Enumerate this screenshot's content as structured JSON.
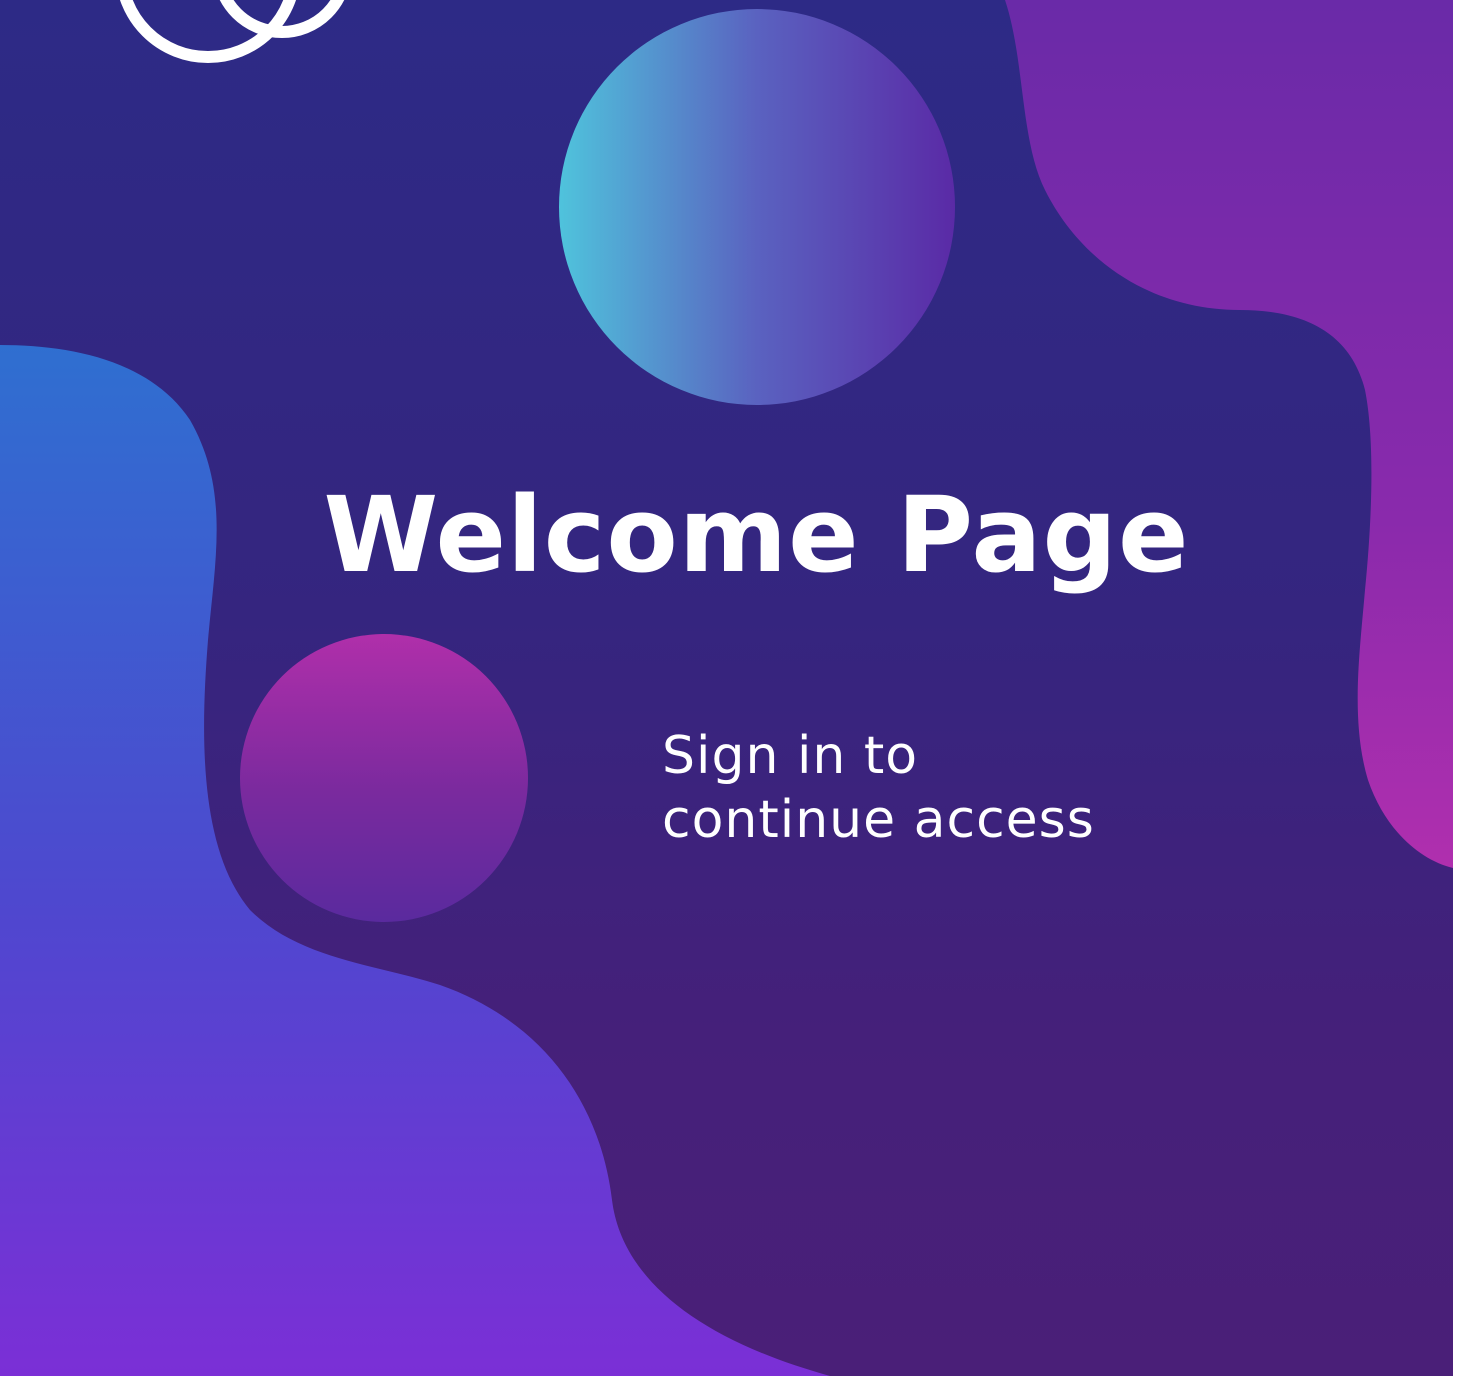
{
  "welcome": {
    "title": "Welcome Page",
    "subtitle_line1": "Sign in to",
    "subtitle_line2": "continue access"
  },
  "logo": {
    "icon": "interlocking-rings-icon",
    "color": "#ffffff"
  },
  "colors": {
    "background_top": "#2d2a86",
    "background_bottom": "#4a1f78",
    "left_blob_top": "#2f6fd0",
    "left_blob_bottom": "#7b2fd6",
    "right_blob_top": "#6a2aa8",
    "right_blob_bottom": "#b02fae",
    "top_orb_left": "#4fc3dc",
    "top_orb_right": "#5a2aa6",
    "small_orb_top": "#b02faa",
    "small_orb_bottom": "#5a2a9e",
    "text": "#ffffff"
  }
}
